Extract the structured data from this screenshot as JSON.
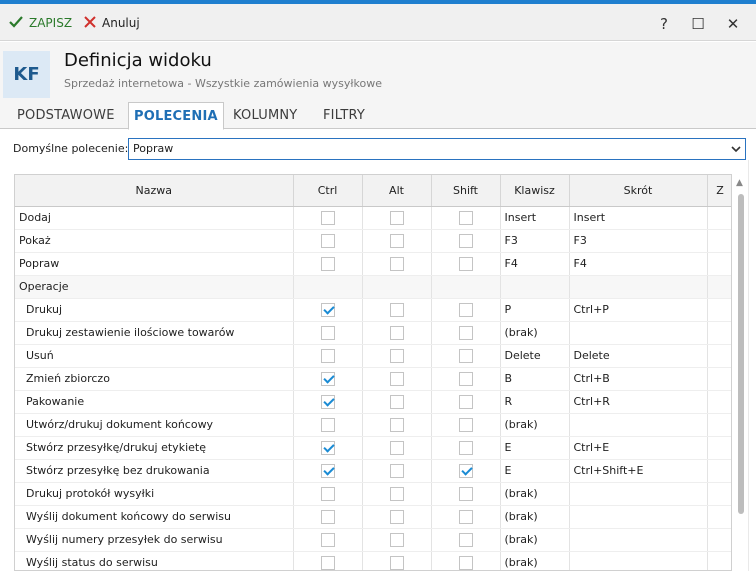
{
  "toolbar": {
    "save_label": "ZAPISZ",
    "cancel_label": "Anuluj"
  },
  "window": {
    "help": "?",
    "maximize": "☐",
    "close": "✕"
  },
  "header": {
    "avatar": "KF",
    "title": "Definicja widoku",
    "subtitle": "Sprzedaż internetowa - Wszystkie zamówienia wysyłkowe"
  },
  "tabs": [
    "PODSTAWOWE",
    "POLECENIA",
    "KOLUMNY",
    "FILTRY"
  ],
  "active_tab": "POLECENIA",
  "default_command": {
    "label": "Domyślne polecenie:",
    "value": "Popraw"
  },
  "grid": {
    "columns": [
      "Nazwa",
      "Ctrl",
      "Alt",
      "Shift",
      "Klawisz",
      "Skrót",
      "Z"
    ],
    "rows": [
      {
        "name": "Dodaj",
        "ctrl": false,
        "alt": false,
        "shift": false,
        "key": "Insert",
        "shortcut": "Insert"
      },
      {
        "name": "Pokaż",
        "ctrl": false,
        "alt": false,
        "shift": false,
        "key": "F3",
        "shortcut": "F3"
      },
      {
        "name": "Popraw",
        "ctrl": false,
        "alt": false,
        "shift": false,
        "key": "F4",
        "shortcut": "F4"
      },
      {
        "name": "Operacje",
        "group": true
      },
      {
        "name": "Drukuj",
        "ctrl": true,
        "alt": false,
        "shift": false,
        "key": "P",
        "shortcut": "Ctrl+P",
        "indent": true
      },
      {
        "name": "Drukuj zestawienie ilościowe towarów",
        "ctrl": false,
        "alt": false,
        "shift": false,
        "key": "(brak)",
        "shortcut": "",
        "indent": true
      },
      {
        "name": "Usuń",
        "ctrl": false,
        "alt": false,
        "shift": false,
        "key": "Delete",
        "shortcut": "Delete",
        "indent": true
      },
      {
        "name": "Zmień zbiorczo",
        "ctrl": true,
        "alt": false,
        "shift": false,
        "key": "B",
        "shortcut": "Ctrl+B",
        "indent": true
      },
      {
        "name": "Pakowanie",
        "ctrl": true,
        "alt": false,
        "shift": false,
        "key": "R",
        "shortcut": "Ctrl+R",
        "indent": true
      },
      {
        "name": "Utwórz/drukuj dokument końcowy",
        "ctrl": false,
        "alt": false,
        "shift": false,
        "key": "(brak)",
        "shortcut": "",
        "indent": true
      },
      {
        "name": "Stwórz przesyłkę/drukuj etykietę",
        "ctrl": true,
        "alt": false,
        "shift": false,
        "key": "E",
        "shortcut": "Ctrl+E",
        "indent": true
      },
      {
        "name": "Stwórz przesyłkę bez drukowania",
        "ctrl": true,
        "alt": false,
        "shift": true,
        "key": "E",
        "shortcut": "Ctrl+Shift+E",
        "indent": true
      },
      {
        "name": "Drukuj protokół wysyłki",
        "ctrl": false,
        "alt": false,
        "shift": false,
        "key": "(brak)",
        "shortcut": "",
        "indent": true
      },
      {
        "name": "Wyślij dokument końcowy do serwisu",
        "ctrl": false,
        "alt": false,
        "shift": false,
        "key": "(brak)",
        "shortcut": "",
        "indent": true
      },
      {
        "name": "Wyślij numery przesyłek do serwisu",
        "ctrl": false,
        "alt": false,
        "shift": false,
        "key": "(brak)",
        "shortcut": "",
        "indent": true
      },
      {
        "name": "Wyślij status do serwisu",
        "ctrl": false,
        "alt": false,
        "shift": false,
        "key": "(brak)",
        "shortcut": "",
        "indent": true
      }
    ]
  },
  "colors": {
    "accent": "#1f7fcf",
    "save": "#2b7a2b",
    "cancel": "#d0312d",
    "check": "#1a8bd4"
  },
  "icons": {
    "save": "check-icon",
    "cancel": "x-icon",
    "dropdown": "chevron-down-icon"
  }
}
